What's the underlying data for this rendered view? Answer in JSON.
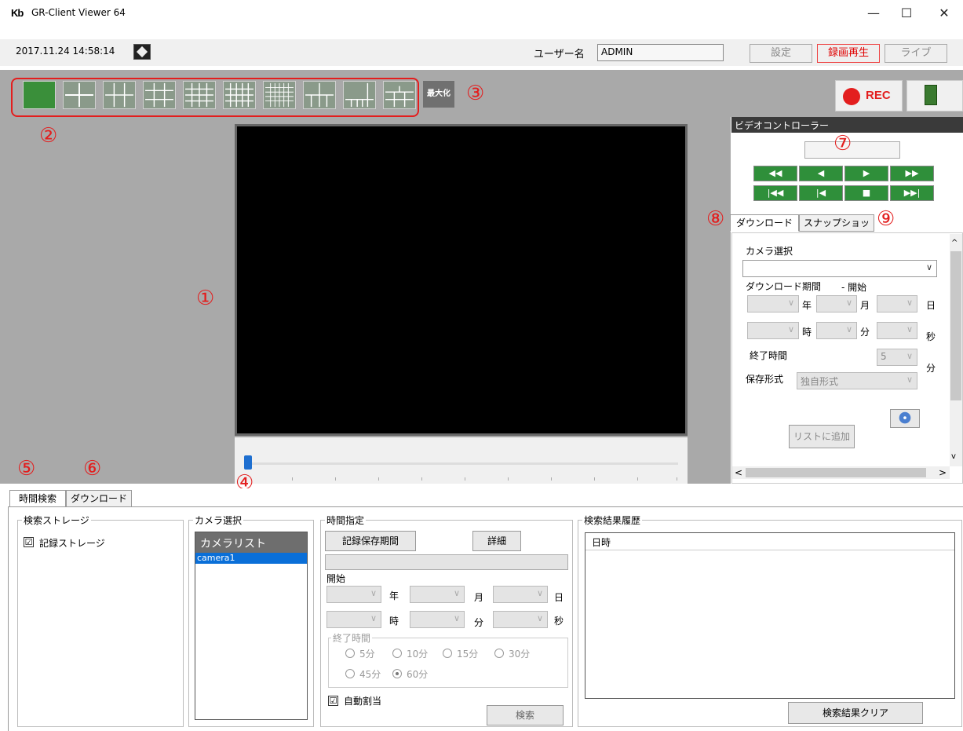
{
  "window": {
    "logo": "Kb",
    "title": "GR-Client Viewer 64",
    "minimize": "—",
    "maximize": "☐",
    "close": "✕"
  },
  "status": {
    "datetime": "2017.11.24 14:58:14",
    "user_label": "ユーザー名",
    "user_value": "ADMIN",
    "settings": "設定",
    "playback": "録画再生",
    "live": "ライブ"
  },
  "toolbar": {
    "maximize_label": "最大化",
    "rec_label": "REC"
  },
  "annotations": {
    "n1": "①",
    "n2": "②",
    "n3": "③",
    "n4": "④",
    "n5": "⑤",
    "n6": "⑥",
    "n7": "⑦",
    "n8": "⑧",
    "n9": "⑨"
  },
  "video_controller": {
    "title": "ビデオコントローラー",
    "buttons_row1": [
      "◀◀",
      "◀",
      "▶",
      "▶▶"
    ],
    "buttons_row2": [
      "|◀◀",
      "|◀",
      "■",
      "▶▶|"
    ],
    "tabs": [
      "ダウンロード",
      "スナップショット"
    ],
    "camera_select": "カメラ選択",
    "download_period": "ダウンロード期間",
    "start": "- 開始",
    "year": "年",
    "month": "月",
    "day": "日",
    "hour": "時",
    "minute": "分",
    "second": "秒",
    "end_time": "終了時間",
    "end_value": "5",
    "end_unit": "分",
    "format_label": "保存形式",
    "format_value": "独自形式",
    "add_list": "リストに追加"
  },
  "bottom": {
    "tabs": [
      "時間検索",
      "ダウンロード"
    ],
    "storage": {
      "title": "検索ストレージ",
      "check": "☑",
      "item": "記録ストレージ"
    },
    "camera": {
      "title": "カメラ選択",
      "header": "カメラリスト",
      "items": [
        "camera1"
      ]
    },
    "time": {
      "title": "時間指定",
      "record_period": "記録保存期間",
      "detail": "詳細",
      "start": "開始",
      "year": "年",
      "month": "月",
      "day": "日",
      "hour": "時",
      "minute": "分",
      "second": "秒",
      "end_group": "終了時間",
      "radios": [
        "5分",
        "10分",
        "15分",
        "30分",
        "45分",
        "60分"
      ],
      "selected": "60分",
      "auto_check": "☑",
      "auto": "自動割当",
      "search": "検索"
    },
    "history": {
      "title": "検索結果履歴",
      "col": "日時",
      "clear": "検索結果クリア"
    }
  },
  "colors": {
    "accent_red": "#e31e1e",
    "control_green": "#2f8f3a",
    "toolbar_gray": "#a9a9a9"
  }
}
